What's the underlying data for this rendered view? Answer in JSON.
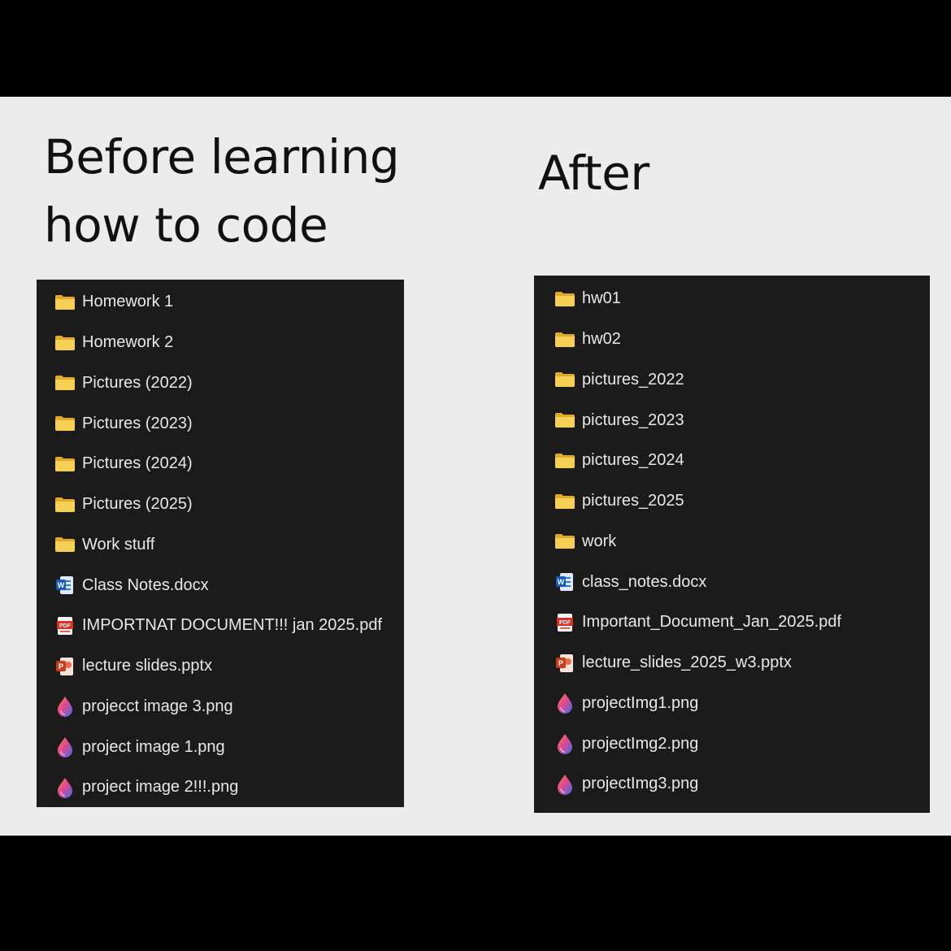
{
  "left": {
    "heading_line1": "Before learning",
    "heading_line2": "how to code",
    "items": [
      {
        "type": "folder",
        "icon": "folder-icon",
        "label": "Homework 1"
      },
      {
        "type": "folder",
        "icon": "folder-icon",
        "label": "Homework 2"
      },
      {
        "type": "folder",
        "icon": "folder-icon",
        "label": "Pictures (2022)"
      },
      {
        "type": "folder",
        "icon": "folder-icon",
        "label": "Pictures (2023)"
      },
      {
        "type": "folder",
        "icon": "folder-icon",
        "label": "Pictures (2024)"
      },
      {
        "type": "folder",
        "icon": "folder-icon",
        "label": "Pictures (2025)"
      },
      {
        "type": "folder",
        "icon": "folder-icon",
        "label": "Work stuff"
      },
      {
        "type": "docx",
        "icon": "word-document-icon",
        "label": "Class Notes.docx"
      },
      {
        "type": "pdf",
        "icon": "pdf-icon",
        "label": "IMPORTNAT DOCUMENT!!! jan 2025.pdf"
      },
      {
        "type": "pptx",
        "icon": "powerpoint-icon",
        "label": "lecture slides.pptx"
      },
      {
        "type": "png",
        "icon": "image-file-icon",
        "label": "projecct image 3.png"
      },
      {
        "type": "png",
        "icon": "image-file-icon",
        "label": "project image 1.png"
      },
      {
        "type": "png",
        "icon": "image-file-icon",
        "label": "project image 2!!!.png"
      }
    ]
  },
  "right": {
    "heading": "After",
    "items": [
      {
        "type": "folder",
        "icon": "folder-icon",
        "label": "hw01"
      },
      {
        "type": "folder",
        "icon": "folder-icon",
        "label": "hw02"
      },
      {
        "type": "folder",
        "icon": "folder-icon",
        "label": "pictures_2022"
      },
      {
        "type": "folder",
        "icon": "folder-icon",
        "label": "pictures_2023"
      },
      {
        "type": "folder",
        "icon": "folder-icon",
        "label": "pictures_2024"
      },
      {
        "type": "folder",
        "icon": "folder-icon",
        "label": "pictures_2025"
      },
      {
        "type": "folder",
        "icon": "folder-icon",
        "label": "work"
      },
      {
        "type": "docx",
        "icon": "word-document-icon",
        "label": "class_notes.docx"
      },
      {
        "type": "pdf",
        "icon": "pdf-icon",
        "label": "Important_Document_Jan_2025.pdf"
      },
      {
        "type": "pptx",
        "icon": "powerpoint-icon",
        "label": "lecture_slides_2025_w3.pptx"
      },
      {
        "type": "png",
        "icon": "image-file-icon",
        "label": "projectImg1.png"
      },
      {
        "type": "png",
        "icon": "image-file-icon",
        "label": "projectImg2.png"
      },
      {
        "type": "png",
        "icon": "image-file-icon",
        "label": "projectImg3.png"
      }
    ]
  },
  "colors": {
    "background": "#ececec",
    "frame": "#000000",
    "panel": "#1b1b1b",
    "text": "#e8e8e8",
    "folder": "#f2c94c"
  }
}
